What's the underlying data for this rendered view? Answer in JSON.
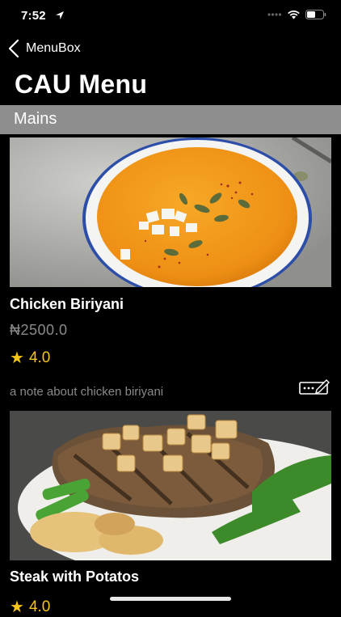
{
  "status": {
    "time": "7:52"
  },
  "nav": {
    "back_label": "MenuBox"
  },
  "page": {
    "title": "CAU Menu"
  },
  "section": {
    "title": "Mains"
  },
  "items": [
    {
      "name": "Chicken Biriyani",
      "price": "₦2500.0",
      "rating": "4.0",
      "note": "a note about chicken biriyani"
    },
    {
      "name": "Steak with Potatos",
      "rating": "4.0"
    }
  ],
  "colors": {
    "accent": "#f5c518",
    "section_bg": "#8e8e8e",
    "muted": "#8a8a8a"
  }
}
